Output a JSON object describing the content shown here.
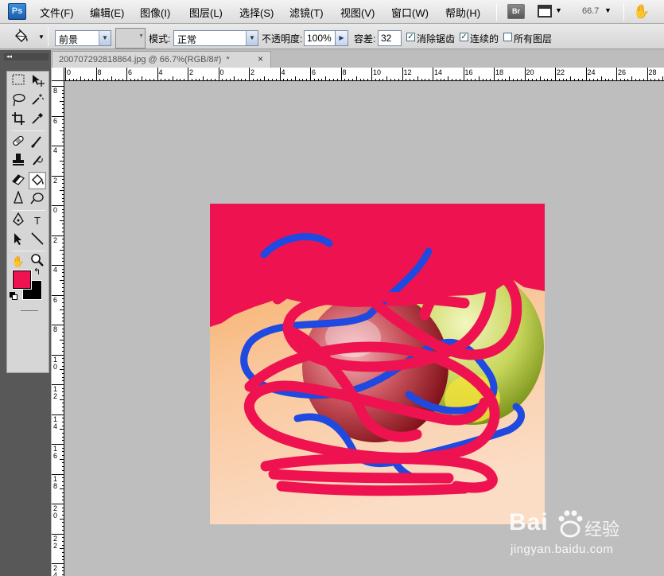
{
  "app": {
    "logo_text": "Ps",
    "menus": [
      "文件(F)",
      "编辑(E)",
      "图像(I)",
      "图层(L)",
      "选择(S)",
      "滤镜(T)",
      "视图(V)",
      "窗口(W)",
      "帮助(H)"
    ],
    "bridge_label": "Br",
    "zoom_value": "66.7"
  },
  "options_bar": {
    "fill_source": "前景",
    "mode_label": "模式:",
    "mode_value": "正常",
    "opacity_label": "不透明度:",
    "opacity_value": "100%",
    "tolerance_label": "容差:",
    "tolerance_value": "32",
    "antialias_label": "消除锯齿",
    "antialias_checked": true,
    "contiguous_label": "连续的",
    "contiguous_checked": true,
    "all_layers_label": "所有图层",
    "all_layers_checked": false
  },
  "toolbox": {
    "header_glyph": "◂◂",
    "selected_tool": "paint-bucket",
    "foreground_color": "#ee1350",
    "background_color": "#000000",
    "type_tool_label": "T"
  },
  "document": {
    "tab_title": "200707292818864.jpg @ 66.7%(RGB/8#)",
    "tab_modified": "*",
    "close_glyph": "×"
  },
  "ruler": {
    "top_labels": [
      "0",
      "8",
      "6",
      "4",
      "2",
      "0",
      "2",
      "4",
      "6",
      "8",
      "10",
      "12",
      "14",
      "16",
      "18",
      "20",
      "22",
      "24",
      "26",
      "28"
    ],
    "left_labels": [
      "8",
      "6",
      "4",
      "2",
      "0",
      "2",
      "4",
      "6",
      "8",
      "10",
      "12",
      "14",
      "16",
      "18",
      "20",
      "22",
      "24"
    ]
  },
  "watermark": {
    "brand": "Bai",
    "brand_suffix": "经验",
    "url": "jingyan.baidu.com"
  }
}
